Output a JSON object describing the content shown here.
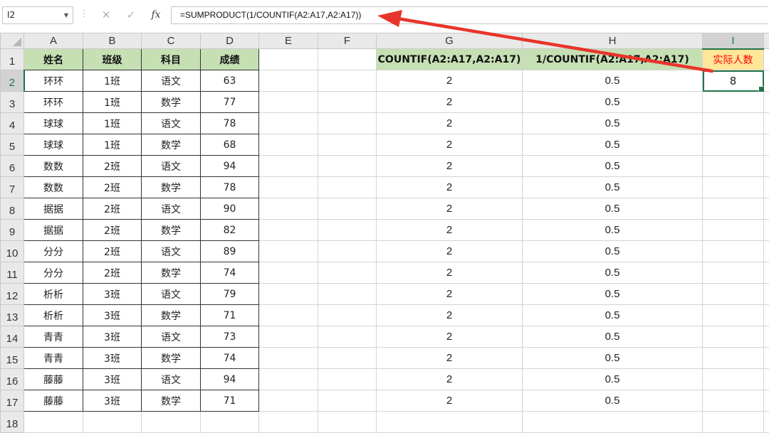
{
  "formula_bar": {
    "name_box": "I2",
    "cancel_icon": "✕",
    "enter_icon": "✓",
    "fx_icon": "fx",
    "formula": "=SUMPRODUCT(1/COUNTIF(A2:A17,A2:A17))"
  },
  "columns": [
    "A",
    "B",
    "C",
    "D",
    "E",
    "F",
    "G",
    "H",
    "I"
  ],
  "row_numbers": [
    "1",
    "2",
    "3",
    "4",
    "5",
    "6",
    "7",
    "8",
    "9",
    "10",
    "11",
    "12",
    "13",
    "14",
    "15",
    "16",
    "17",
    "18"
  ],
  "headers": {
    "a": "姓名",
    "b": "班级",
    "c": "科目",
    "d": "成绩",
    "g": "COUNTIF(A2:A17,A2:A17)",
    "h": "1/COUNTIF(A2:A17,A2:A17)",
    "i": "实际人数"
  },
  "result_value": "8",
  "rows": [
    {
      "name": "环环",
      "cls": "1班",
      "subject": "语文",
      "score": "63",
      "g": "2",
      "h": "0.5"
    },
    {
      "name": "环环",
      "cls": "1班",
      "subject": "数学",
      "score": "77",
      "g": "2",
      "h": "0.5"
    },
    {
      "name": "球球",
      "cls": "1班",
      "subject": "语文",
      "score": "78",
      "g": "2",
      "h": "0.5"
    },
    {
      "name": "球球",
      "cls": "1班",
      "subject": "数学",
      "score": "68",
      "g": "2",
      "h": "0.5"
    },
    {
      "name": "数数",
      "cls": "2班",
      "subject": "语文",
      "score": "94",
      "g": "2",
      "h": "0.5"
    },
    {
      "name": "数数",
      "cls": "2班",
      "subject": "数学",
      "score": "78",
      "g": "2",
      "h": "0.5"
    },
    {
      "name": "据据",
      "cls": "2班",
      "subject": "语文",
      "score": "90",
      "g": "2",
      "h": "0.5"
    },
    {
      "name": "据据",
      "cls": "2班",
      "subject": "数学",
      "score": "82",
      "g": "2",
      "h": "0.5"
    },
    {
      "name": "分分",
      "cls": "2班",
      "subject": "语文",
      "score": "89",
      "g": "2",
      "h": "0.5"
    },
    {
      "name": "分分",
      "cls": "2班",
      "subject": "数学",
      "score": "74",
      "g": "2",
      "h": "0.5"
    },
    {
      "name": "析析",
      "cls": "3班",
      "subject": "语文",
      "score": "79",
      "g": "2",
      "h": "0.5"
    },
    {
      "name": "析析",
      "cls": "3班",
      "subject": "数学",
      "score": "71",
      "g": "2",
      "h": "0.5"
    },
    {
      "name": "青青",
      "cls": "3班",
      "subject": "语文",
      "score": "73",
      "g": "2",
      "h": "0.5"
    },
    {
      "name": "青青",
      "cls": "3班",
      "subject": "数学",
      "score": "74",
      "g": "2",
      "h": "0.5"
    },
    {
      "name": "藤藤",
      "cls": "3班",
      "subject": "语文",
      "score": "94",
      "g": "2",
      "h": "0.5"
    },
    {
      "name": "藤藤",
      "cls": "3班",
      "subject": "数学",
      "score": "71",
      "g": "2",
      "h": "0.5"
    }
  ],
  "annotation": {
    "arrow_color": "#e8352b"
  }
}
